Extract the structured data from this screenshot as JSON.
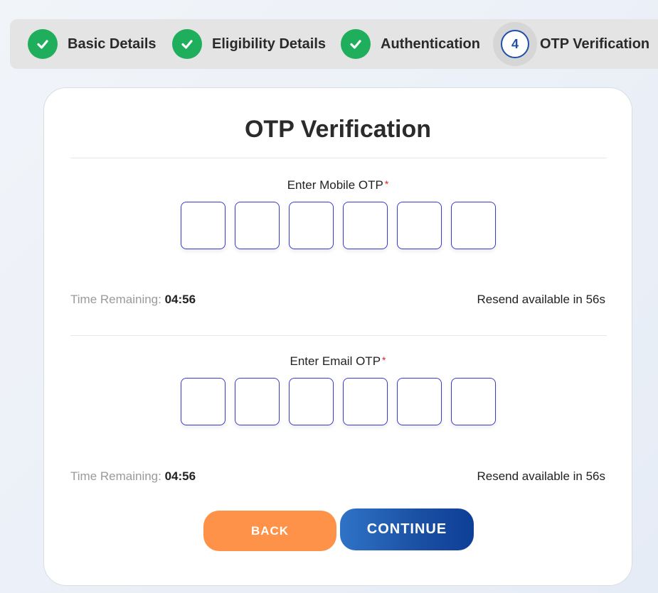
{
  "stepper": {
    "steps": [
      {
        "label": "Basic Details",
        "status": "complete",
        "icon": "check-icon"
      },
      {
        "label": "Eligibility Details",
        "status": "complete",
        "icon": "check-icon"
      },
      {
        "label": "Authentication",
        "status": "complete",
        "icon": "check-icon"
      },
      {
        "number": "4",
        "label": "OTP Verification",
        "status": "current"
      }
    ]
  },
  "card": {
    "title": "OTP Verification",
    "mobile": {
      "label": "Enter Mobile OTP",
      "required_mark": "*",
      "digits": [
        "",
        "",
        "",
        "",
        "",
        ""
      ],
      "time_label": "Time Remaining:",
      "time_value": "04:56",
      "resend_text": "Resend available in 56s"
    },
    "email": {
      "label": "Enter Email OTP",
      "required_mark": "*",
      "digits": [
        "",
        "",
        "",
        "",
        "",
        ""
      ],
      "time_label": "Time Remaining:",
      "time_value": "04:56",
      "resend_text": "Resend available in 56s"
    },
    "back_label": "BACK",
    "continue_label": "CONTINUE"
  },
  "colors": {
    "complete_green": "#1fae5b",
    "primary_blue": "#1a4fa3",
    "back_orange": "#ff9249",
    "otp_border": "#3a3ad0",
    "required_red": "#e02424"
  }
}
